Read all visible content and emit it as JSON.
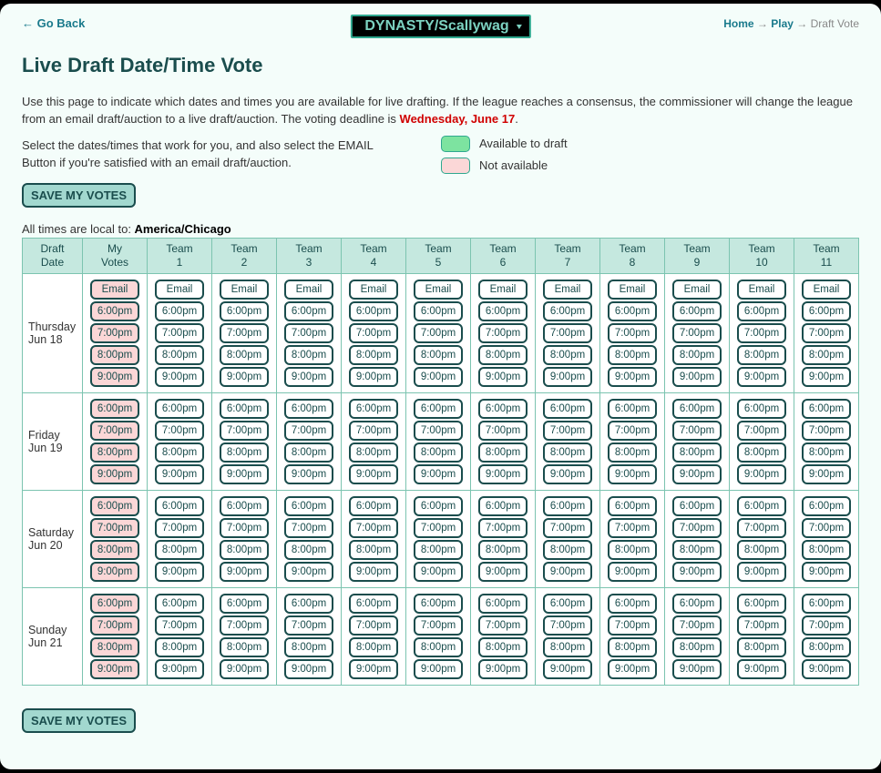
{
  "nav": {
    "go_back": "← Go Back",
    "league_dropdown": "DYNASTY/Scallywag",
    "home": "Home",
    "play": "Play",
    "current": "Draft Vote",
    "arrow": "→"
  },
  "heading": "Live Draft Date/Time Vote",
  "intro_a": "Use this page to indicate which dates and times you are available for live drafting. If the league reaches a consensus, the commissioner will change the league from an email draft/auction to a live draft/auction. The voting deadline is ",
  "deadline": "Wednesday, June 17",
  "intro_b": ".",
  "instruct": "Select the dates/times that work for you, and also select the EMAIL Button if you're satisfied with an email draft/auction.",
  "legend": {
    "available": "Available to draft",
    "not_available": "Not available"
  },
  "save_label": "SAVE MY VOTES",
  "tz_prefix": "All times are local to: ",
  "tz": "America/Chicago",
  "headers": {
    "date": "Draft\nDate",
    "my": "My\nVotes",
    "teams": [
      "Team\n1",
      "Team\n2",
      "Team\n3",
      "Team\n4",
      "Team\n5",
      "Team\n6",
      "Team\n7",
      "Team\n8",
      "Team\n9",
      "Team\n10",
      "Team\n11"
    ]
  },
  "rows": [
    {
      "day": "Thursday",
      "date": "Jun 18",
      "slots": [
        "Email",
        "6:00pm",
        "7:00pm",
        "8:00pm",
        "9:00pm"
      ]
    },
    {
      "day": "Friday",
      "date": "Jun 19",
      "slots": [
        "6:00pm",
        "7:00pm",
        "8:00pm",
        "9:00pm"
      ]
    },
    {
      "day": "Saturday",
      "date": "Jun 20",
      "slots": [
        "6:00pm",
        "7:00pm",
        "8:00pm",
        "9:00pm"
      ]
    },
    {
      "day": "Sunday",
      "date": "Jun 21",
      "slots": [
        "6:00pm",
        "7:00pm",
        "8:00pm",
        "9:00pm"
      ]
    }
  ],
  "team_count": 11
}
